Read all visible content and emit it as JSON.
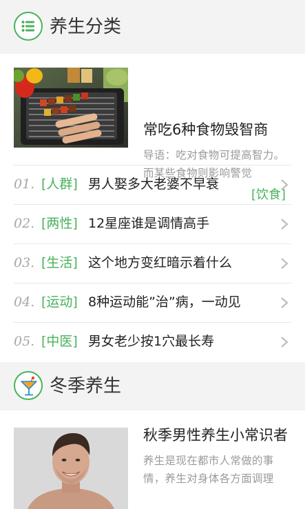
{
  "section1": {
    "title": "养生分类",
    "icon": "list-icon"
  },
  "featured1": {
    "title": "常吃6种食物毁智商",
    "summary": "导语：吃对食物可提高智力。而某些食物则影响警觉",
    "tag": "[饮食]",
    "image": "bbq-grill-image"
  },
  "list": [
    {
      "num": "01.",
      "tag": "[人群]",
      "text": "男人娶多大老婆不早衰"
    },
    {
      "num": "02.",
      "tag": "[两性]",
      "text": "12星座谁是调情高手"
    },
    {
      "num": "03.",
      "tag": "[生活]",
      "text": "这个地方变红暗示着什么"
    },
    {
      "num": "04.",
      "tag": "[运动]",
      "text": "8种运动能”治”病，一动见"
    },
    {
      "num": "05.",
      "tag": "[中医]",
      "text": "男女老少按1穴最长寿"
    }
  ],
  "section2": {
    "title": "冬季养生",
    "icon": "cocktail-icon"
  },
  "featured2": {
    "title": "秋季男性养生小常识者",
    "summary": "养生是现在都市人常做的事情，养生对身体各方面调理",
    "image": "smiling-man-image"
  },
  "colors": {
    "accent": "#49b15b",
    "background": "#f3f3f3",
    "text": "#222222",
    "muted": "#9a9a9a"
  }
}
